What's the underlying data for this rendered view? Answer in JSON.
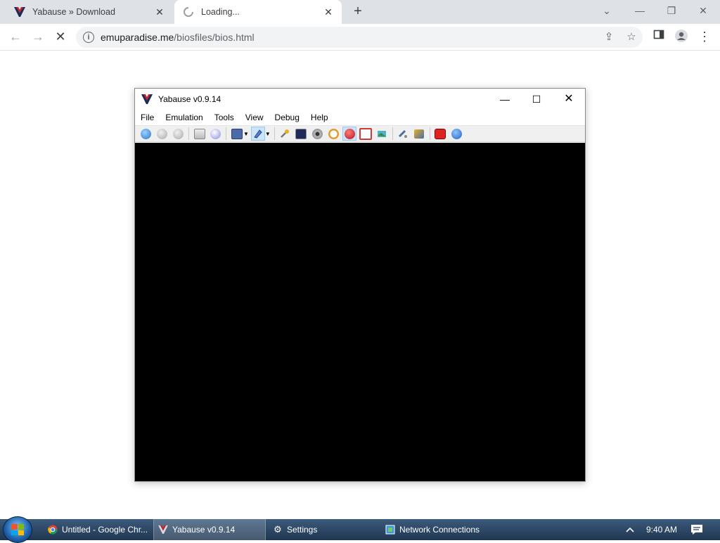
{
  "browser": {
    "tabs": [
      {
        "title": "Yabause » Download",
        "icon": "yabause-logo-icon"
      },
      {
        "title": "Loading...",
        "icon": "loading-spinner-icon"
      }
    ],
    "new_tab": "+",
    "url_host": "emuparadise.me",
    "url_path": "/biosfiles/bios.html"
  },
  "yabause": {
    "title": "Yabause v0.9.14",
    "menu": [
      "File",
      "Emulation",
      "Tools",
      "View",
      "Debug",
      "Help"
    ]
  },
  "taskbar": {
    "items": [
      {
        "label": "Untitled - Google Chr...",
        "icon": "chrome-icon"
      },
      {
        "label": "Yabause v0.9.14",
        "icon": "yabause-logo-icon"
      },
      {
        "label": "Settings",
        "icon": "gear-icon"
      },
      {
        "label": "Network Connections",
        "icon": "network-icon"
      }
    ],
    "clock": "9:40 AM"
  },
  "colors": {
    "tabstrip": "#dee1e6",
    "taskbar": "#2b4766",
    "yabause_logo_red": "#c0282e",
    "yabause_logo_navy": "#1a2a5a"
  }
}
